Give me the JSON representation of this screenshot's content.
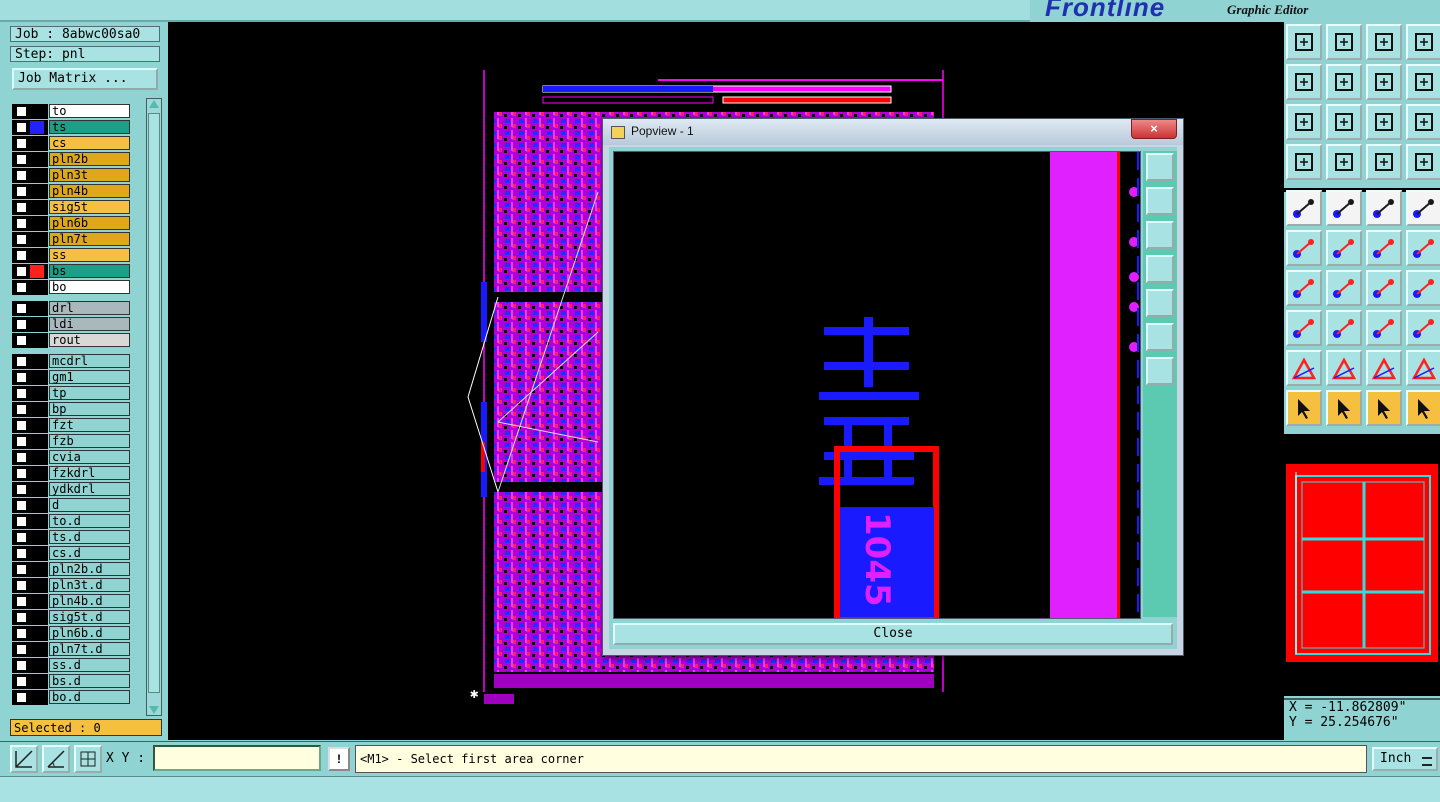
{
  "app": {
    "brand": "Frontline",
    "subtitle": "Graphic Editor"
  },
  "job": {
    "job_label": "Job : 8abwc00sa0",
    "step_label": "Step: pnl",
    "job_matrix_button": "Job Matrix ..."
  },
  "layers": [
    {
      "name": "to",
      "color": "#ffffff",
      "swatch": "#000000"
    },
    {
      "name": "ts",
      "color": "#1aa088",
      "swatch": "#2222ff"
    },
    {
      "name": "cs",
      "color": "#f5c040",
      "swatch": "#000000"
    },
    {
      "name": "pln2b",
      "color": "#e0a818",
      "swatch": "#000000"
    },
    {
      "name": "pln3t",
      "color": "#e0a818",
      "swatch": "#000000"
    },
    {
      "name": "pln4b",
      "color": "#e0a818",
      "swatch": "#000000"
    },
    {
      "name": "sig5t",
      "color": "#f5c040",
      "swatch": "#000000"
    },
    {
      "name": "pln6b",
      "color": "#e0a818",
      "swatch": "#000000"
    },
    {
      "name": "pln7t",
      "color": "#e0a818",
      "swatch": "#000000"
    },
    {
      "name": "ss",
      "color": "#f5c040",
      "swatch": "#000000"
    },
    {
      "name": "bs",
      "color": "#1aa088",
      "swatch": "#ff2020"
    },
    {
      "name": "bo",
      "color": "#ffffff",
      "swatch": "#000000"
    },
    {
      "name": "drl",
      "color": "#a9b8bc",
      "swatch": "#000000"
    },
    {
      "name": "ldi",
      "color": "#a9b8bc",
      "swatch": "#000000"
    },
    {
      "name": "rout",
      "color": "#d8d8d8",
      "swatch": "#000000"
    },
    {
      "name": "mcdrl",
      "color": "#8fd3d3",
      "swatch": "#000000"
    },
    {
      "name": "gm1",
      "color": "#8fd3d3",
      "swatch": "#000000"
    },
    {
      "name": "tp",
      "color": "#8fd3d3",
      "swatch": "#000000"
    },
    {
      "name": "bp",
      "color": "#8fd3d3",
      "swatch": "#000000"
    },
    {
      "name": "fzt",
      "color": "#8fd3d3",
      "swatch": "#000000"
    },
    {
      "name": "fzb",
      "color": "#8fd3d3",
      "swatch": "#000000"
    },
    {
      "name": "cvia",
      "color": "#8fd3d3",
      "swatch": "#000000"
    },
    {
      "name": "fzkdrl",
      "color": "#8fd3d3",
      "swatch": "#000000"
    },
    {
      "name": "ydkdrl",
      "color": "#8fd3d3",
      "swatch": "#000000"
    },
    {
      "name": "d",
      "color": "#8fd3d3",
      "swatch": "#000000"
    },
    {
      "name": "to.d",
      "color": "#8fd3d3",
      "swatch": "#000000"
    },
    {
      "name": "ts.d",
      "color": "#8fd3d3",
      "swatch": "#000000"
    },
    {
      "name": "cs.d",
      "color": "#8fd3d3",
      "swatch": "#000000"
    },
    {
      "name": "pln2b.d",
      "color": "#8fd3d3",
      "swatch": "#000000"
    },
    {
      "name": "pln3t.d",
      "color": "#8fd3d3",
      "swatch": "#000000"
    },
    {
      "name": "pln4b.d",
      "color": "#8fd3d3",
      "swatch": "#000000"
    },
    {
      "name": "sig5t.d",
      "color": "#8fd3d3",
      "swatch": "#000000"
    },
    {
      "name": "pln6b.d",
      "color": "#8fd3d3",
      "swatch": "#000000"
    },
    {
      "name": "pln7t.d",
      "color": "#8fd3d3",
      "swatch": "#000000"
    },
    {
      "name": "ss.d",
      "color": "#8fd3d3",
      "swatch": "#000000"
    },
    {
      "name": "bs.d",
      "color": "#8fd3d3",
      "swatch": "#000000"
    },
    {
      "name": "bo.d",
      "color": "#8fd3d3",
      "swatch": "#000000"
    }
  ],
  "selected": "Selected : 0",
  "popview": {
    "title": "Popview - 1",
    "close_label": "Close",
    "close_glyph": "×",
    "board_text": "1045"
  },
  "status": {
    "xy_label": "X Y :",
    "xy_value": "",
    "warn_glyph": "!",
    "prompt": "<M1> - Select first area corner",
    "unit": "Inch"
  },
  "coords": {
    "x": "X = -11.862809\"",
    "y": "Y = 25.254676\""
  },
  "colors": {
    "panel": "#8fd3d3",
    "button": "#a8e2e2",
    "accent_yellow": "#f5c040",
    "canvas": "#000000",
    "magenta": "#e020ff",
    "blue": "#1a1aff",
    "red": "#ff0000"
  },
  "icons": [
    "zoom-window-icon",
    "zoom-home-icon",
    "pan-icon",
    "measure-icon",
    "snap-icon",
    "select-arrow-icon",
    "help-icon",
    "close-icon"
  ]
}
